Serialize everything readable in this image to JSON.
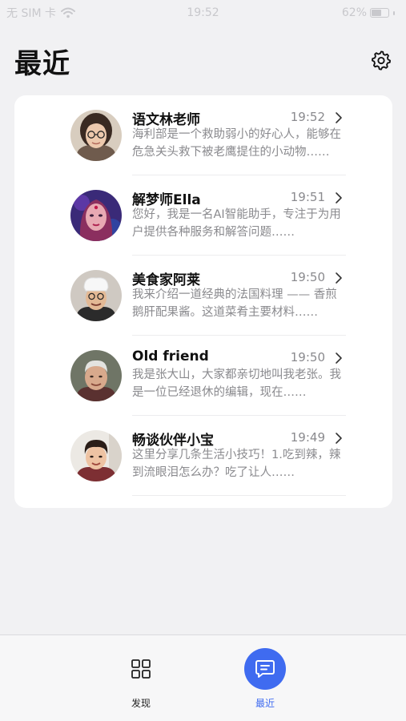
{
  "status_bar": {
    "carrier": "无 SIM 卡",
    "time": "19:52",
    "battery_percent": "62%",
    "battery_level": 0.62
  },
  "header": {
    "title": "最近",
    "settings_icon": "gear-icon"
  },
  "chats": [
    {
      "name": "语文林老师",
      "time": "19:52",
      "preview": "海利部是一个救助弱小的好心人，能够在危急关头救下被老鹰提住的小动物……",
      "avatar": "teacher-avatar"
    },
    {
      "name": "解梦师Ella",
      "time": "19:51",
      "preview": "您好，我是一名AI智能助手，专注于为用户提供各种服务和解答问题……",
      "avatar": "dream-interpreter-avatar"
    },
    {
      "name": "美食家阿莱",
      "time": "19:50",
      "preview": "我来介绍一道经典的法国料理 —— 香煎鹅肝配果酱。这道菜肴主要材料……",
      "avatar": "chef-avatar"
    },
    {
      "name": "Old friend",
      "time": "19:50",
      "preview": "我是张大山，大家都亲切地叫我老张。我是一位已经退休的编辑，现在……",
      "avatar": "old-friend-avatar"
    },
    {
      "name": "畅谈伙伴小宝",
      "time": "19:49",
      "preview": "这里分享几条生活小技巧！1.吃到辣，辣到流眼泪怎么办？吃了让人……",
      "avatar": "chat-buddy-avatar"
    }
  ],
  "tab_bar": {
    "discover_label": "发现",
    "recent_label": "最近",
    "active": "recent",
    "accent_color": "#3f6bf0"
  }
}
